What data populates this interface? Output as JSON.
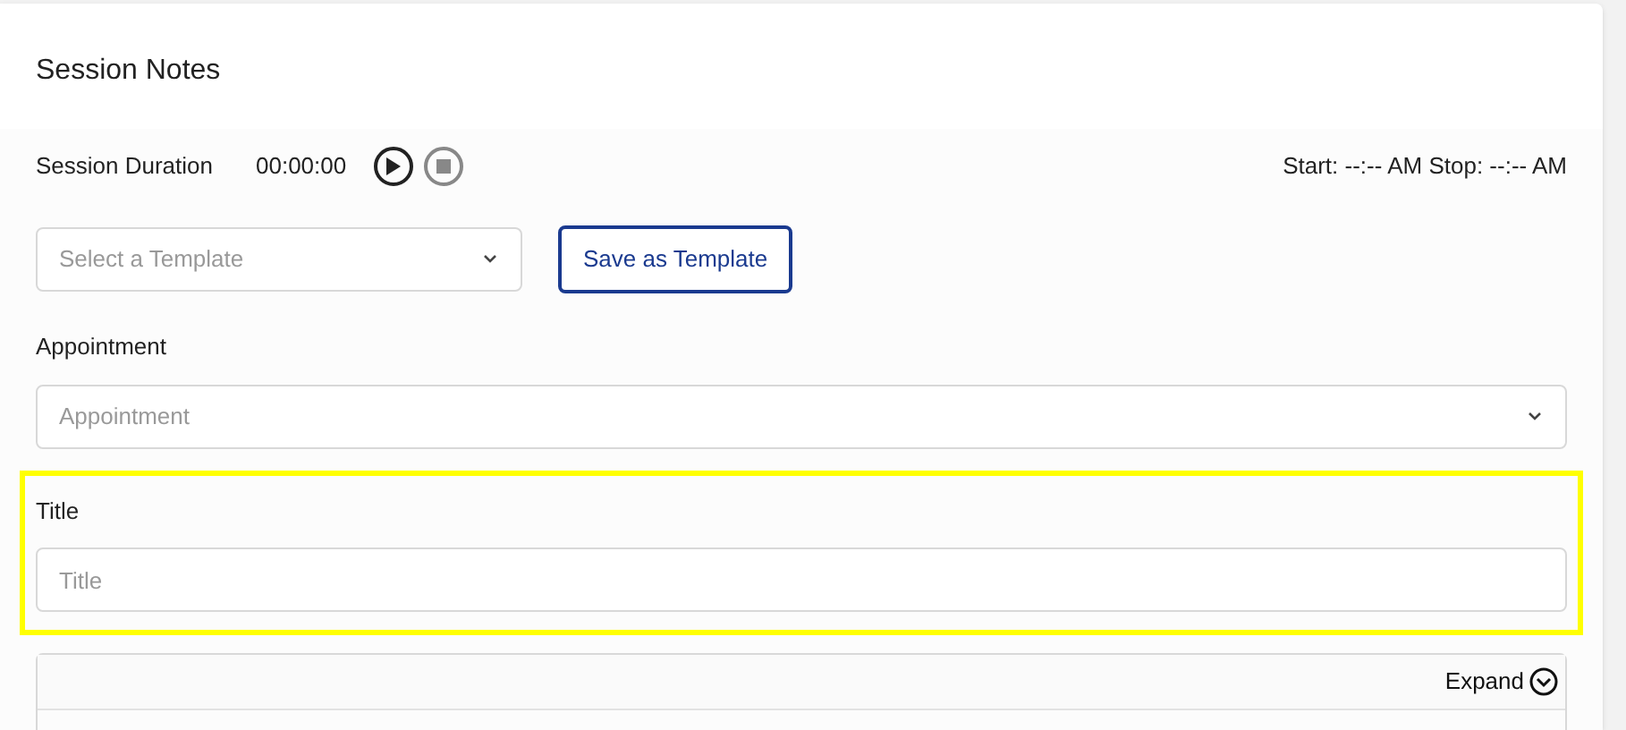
{
  "card": {
    "title": "Session Notes"
  },
  "timer": {
    "label": "Session Duration",
    "time": "00:00:00",
    "running": false,
    "range": "Start: --:-- AM Stop: --:-- AM"
  },
  "template": {
    "placeholder": "Select a Template",
    "button": "Save as Template"
  },
  "appointment": {
    "label": "Appointment",
    "placeholder": "Appointment"
  },
  "title_field": {
    "label": "Title",
    "placeholder": "Title",
    "highlighted": true
  },
  "editor": {
    "expand": "Expand"
  }
}
